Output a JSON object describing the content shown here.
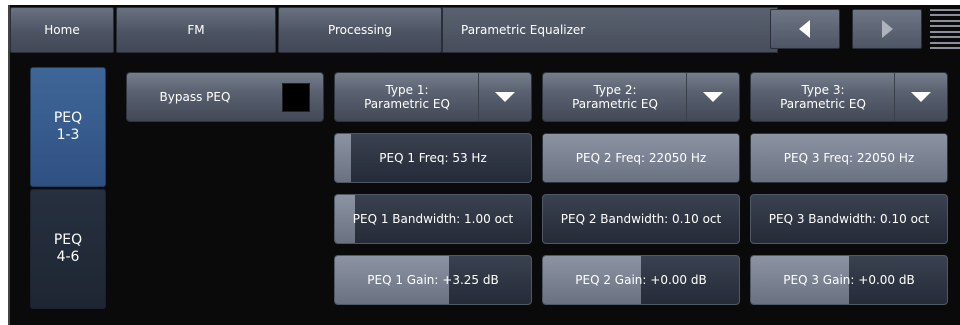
{
  "header": {
    "home_label": "Home",
    "fm_label": "FM",
    "processing_label": "Processing",
    "title": "Parametric Equalizer"
  },
  "side_tabs": [
    {
      "line1": "PEQ",
      "line2": "1-3",
      "active": true
    },
    {
      "line1": "PEQ",
      "line2": "4-6",
      "active": false
    }
  ],
  "bypass": {
    "label": "Bypass PEQ",
    "checked": false
  },
  "types": [
    {
      "line1": "Type 1:",
      "line2": "Parametric EQ"
    },
    {
      "line1": "Type 2:",
      "line2": "Parametric EQ"
    },
    {
      "line1": "Type 3:",
      "line2": "Parametric EQ"
    }
  ],
  "freqs": [
    {
      "label": "PEQ 1 Freq: 53 Hz",
      "level": 0.08
    },
    {
      "label": "PEQ 2 Freq: 22050 Hz",
      "level": 1.0
    },
    {
      "label": "PEQ 3 Freq: 22050 Hz",
      "level": 1.0
    }
  ],
  "bandwidths": [
    {
      "label": "PEQ 1 Bandwidth: 1.00 oct",
      "level": 0.1
    },
    {
      "label": "PEQ 2 Bandwidth: 0.10 oct",
      "level": 0.0
    },
    {
      "label": "PEQ 3 Bandwidth: 0.10 oct",
      "level": 0.0
    }
  ],
  "gains": [
    {
      "label": "PEQ 1 Gain: +3.25 dB",
      "level": 0.58
    },
    {
      "label": "PEQ 2 Gain: +0.00 dB",
      "level": 0.5
    },
    {
      "label": "PEQ 3 Gain: +0.00 dB",
      "level": 0.5
    }
  ],
  "icons": {
    "prev": "triangle-left-icon",
    "next": "triangle-right-icon",
    "menu": "hamburger-menu-icon",
    "dropdown": "triangle-down-icon"
  }
}
